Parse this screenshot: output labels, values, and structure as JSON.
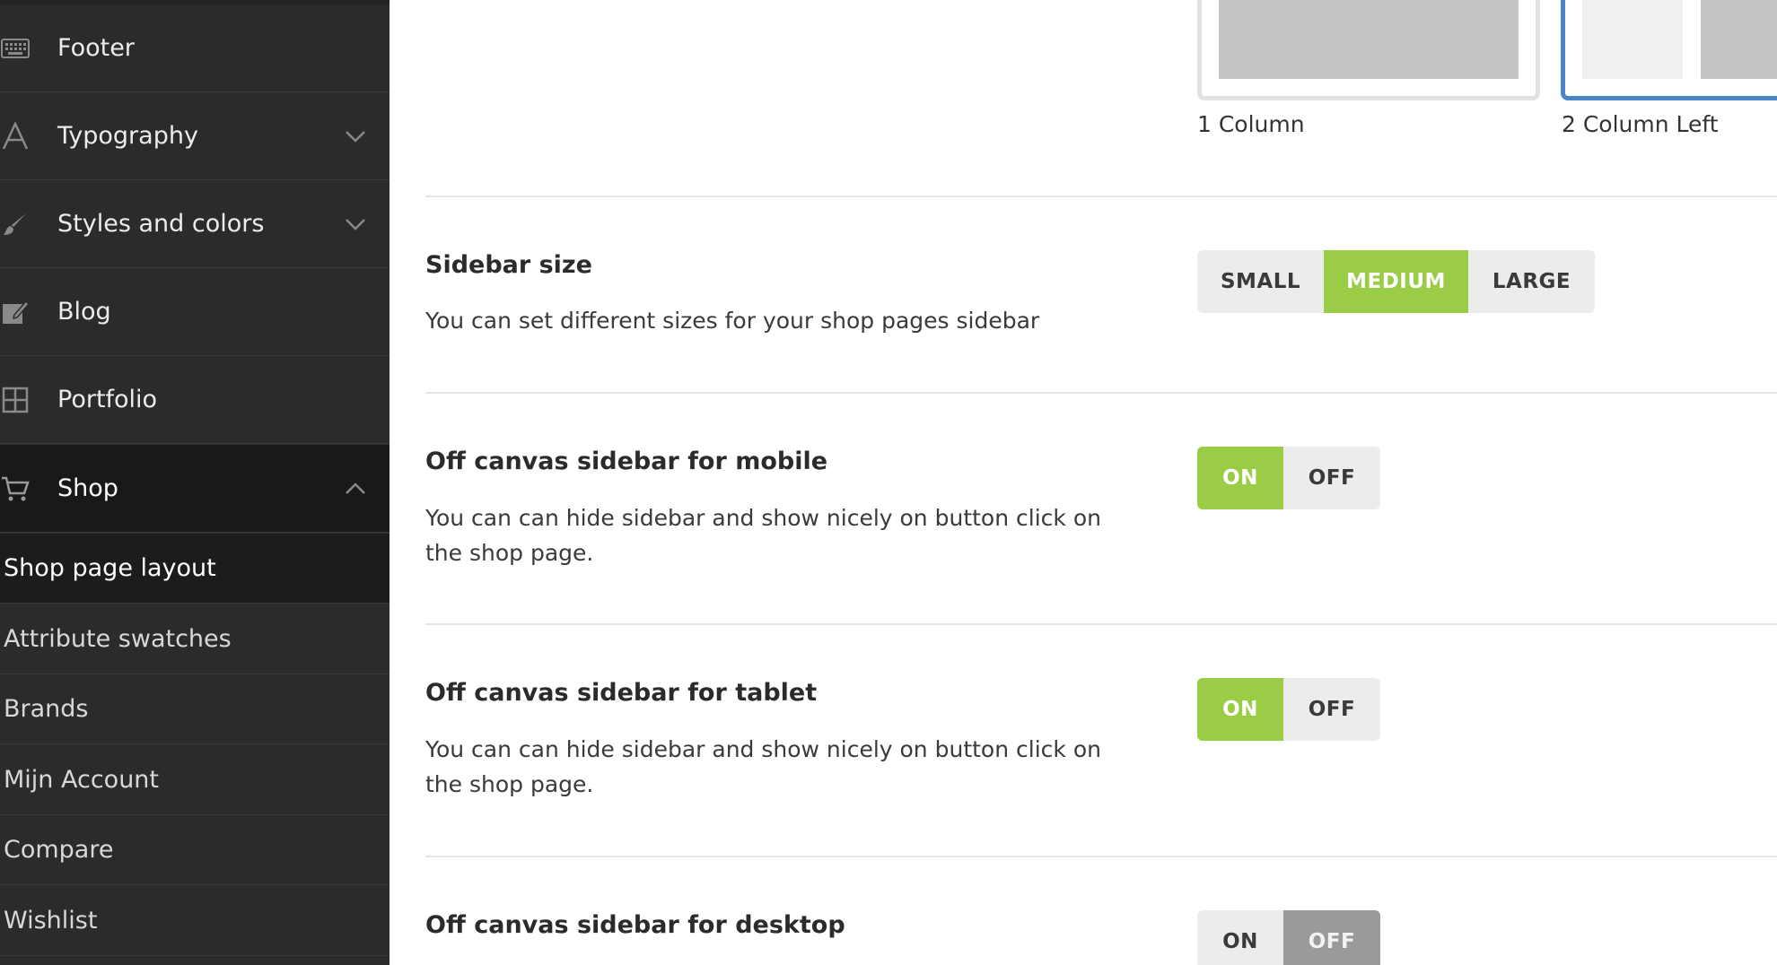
{
  "sidebar": {
    "items": [
      {
        "label": "Footer",
        "icon": "keyboard-icon"
      },
      {
        "label": "Typography",
        "icon": "typography-icon"
      },
      {
        "label": "Styles and colors",
        "icon": "brush-icon"
      },
      {
        "label": "Blog",
        "icon": "edit-icon"
      },
      {
        "label": "Portfolio",
        "icon": "grid-icon"
      },
      {
        "label": "Shop",
        "icon": "cart-icon"
      }
    ],
    "sub_items": [
      {
        "label": "Shop page layout"
      },
      {
        "label": "Attribute swatches"
      },
      {
        "label": "Brands"
      },
      {
        "label": "Mijn Account"
      },
      {
        "label": "Compare"
      },
      {
        "label": "Wishlist"
      }
    ]
  },
  "layouts": {
    "options": [
      {
        "label": "1 Column",
        "selected": false
      },
      {
        "label": "2 Column Left",
        "selected": true
      }
    ]
  },
  "settings": {
    "sidebar_size": {
      "title": "Sidebar size",
      "description": "You can set different sizes for your shop pages sidebar",
      "options": [
        "SMALL",
        "MEDIUM",
        "LARGE"
      ],
      "selected": "MEDIUM"
    },
    "offcanvas_mobile": {
      "title": "Off canvas sidebar for mobile",
      "description": "You can can hide sidebar and show nicely on button click on the shop page.",
      "on_label": "ON",
      "off_label": "OFF",
      "value": "ON"
    },
    "offcanvas_tablet": {
      "title": "Off canvas sidebar for tablet",
      "description": "You can can hide sidebar and show nicely on button click on the shop page.",
      "on_label": "ON",
      "off_label": "OFF",
      "value": "ON"
    },
    "offcanvas_desktop": {
      "title": "Off canvas sidebar for desktop",
      "on_label": "ON",
      "off_label": "OFF",
      "value": "OFF"
    }
  },
  "colors": {
    "accent_green": "#9acc45",
    "selected_border": "#4a86c6",
    "sidebar_bg": "#2b2b2b"
  }
}
